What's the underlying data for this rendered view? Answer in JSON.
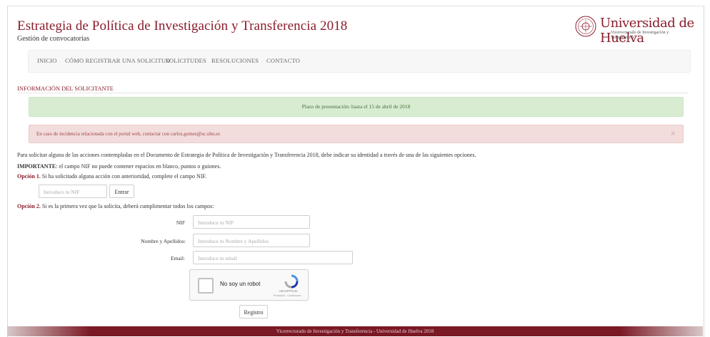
{
  "header": {
    "title": "Estrategia de Política de Investigación y Transferencia 2018",
    "subtitle": "Gestión de convocatorias",
    "university_name": "Universidad de Huelva",
    "university_sub": "Vicerrectorado de Investigación y Transferencia"
  },
  "nav": {
    "items": [
      "INICIO",
      "CÓMO REGISTRAR UNA SOLICITUD",
      "SOLICITUDES",
      "RESOLUCIONES",
      "CONTACTO"
    ]
  },
  "section": {
    "heading": "INFORMACIÓN DEL SOLICITANTE"
  },
  "alerts": {
    "deadline": "Plazo de presentación: hasta el 15 de abril de 2018",
    "contact": "En caso de incidencia relacionada con el portal web, contactar con carlos.gomez@sc.uhu.es",
    "close": "×"
  },
  "intro": {
    "text": "Para solicitar alguna de las acciones contempladas en el Documento de Estrategia de Política de Investigación y Transferencia 2018, debe indicar su identidad a través de una de las siguientes opciones.",
    "important_label": "IMPORTANTE",
    "important_text": ": el campo NIF no puede contener espacios en blanco, puntos o guiones."
  },
  "option1": {
    "label": "Opción 1.",
    "text": " Si ha solicitado alguna acción con anterioridad, complete el campo NIF.",
    "nif_placeholder": "Introduce tu NIF",
    "enter_button": "Entrar"
  },
  "option2": {
    "label": "Opción 2.",
    "text": " Si es la primera vez que la solicita, deberá cumplimentar todos los campos:",
    "nif_label": "NIF",
    "nif_placeholder": "Introduce tu NIF",
    "name_label": "Nombre y Apellidos:",
    "name_placeholder": "Introduce tu Nombre y Apellidos",
    "email_label": "Email:",
    "email_placeholder": "Introduce tu email",
    "register_button": "Registro"
  },
  "captcha": {
    "text": "No soy un robot",
    "brand": "reCAPTCHA",
    "links": "Privacidad - Condiciones"
  },
  "footer": {
    "text": "Vicerrectorado de Investigación y Transferencia - Universidad de Huelva 2018"
  },
  "colors": {
    "brand": "#8a1c2b",
    "success_bg": "#d7ecd1",
    "danger_bg": "#f2dcdc"
  }
}
